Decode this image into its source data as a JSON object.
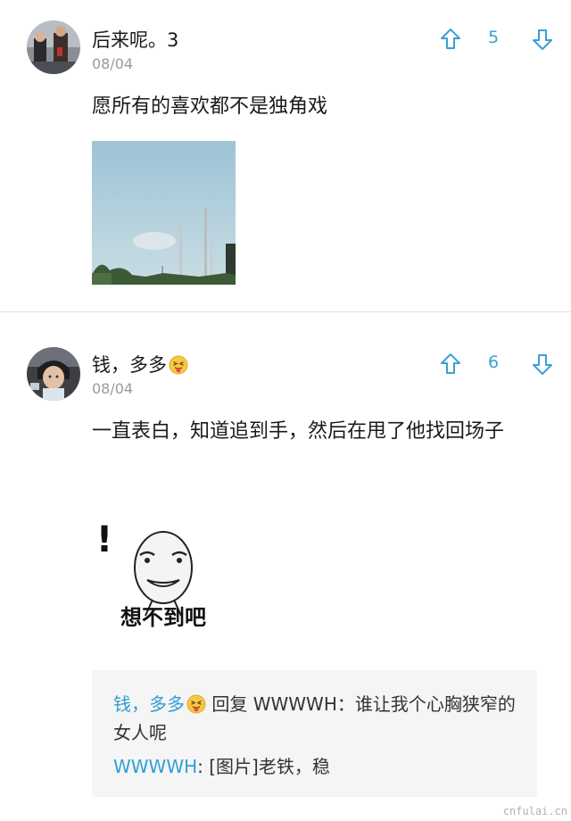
{
  "posts": [
    {
      "username": "后来呢。3",
      "date": "08/04",
      "vote_count": "5",
      "text": "愿所有的喜欢都不是独角戏",
      "image": "sky-photo"
    },
    {
      "username": "钱，多多",
      "username_emoji": "tongue-face-emoji",
      "date": "08/04",
      "vote_count": "6",
      "text": "一直表白，知道追到手，然后在甩了他找回场子",
      "image": "meme-sticker",
      "image_caption": "想不到吧",
      "image_exclaim": "!",
      "reply": {
        "line1_name": "钱，多多",
        "line1_text": " 回复 WWWWH：谁让我个心胸狭窄的女人呢",
        "line2_name": "WWWWH",
        "line2_text": ": [图片]老铁，稳"
      }
    }
  ],
  "colors": {
    "accent": "#3aa0d6",
    "reply_name": "#2ea0d4",
    "date": "#9a9a9a",
    "reply_bg": "#f5f5f5"
  },
  "watermark": "cnfulai.cn"
}
